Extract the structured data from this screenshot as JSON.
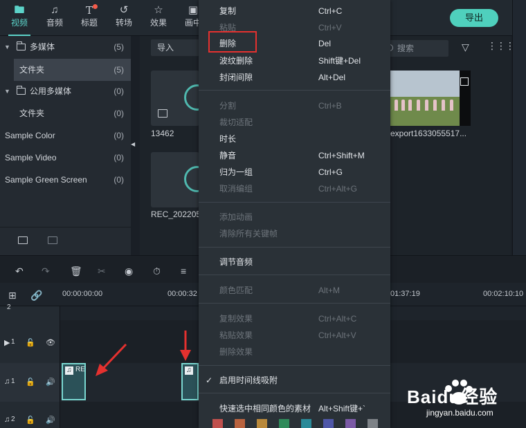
{
  "toolbar": {
    "tabs": [
      {
        "label": "视频",
        "icon": "folder-icon",
        "active": true
      },
      {
        "label": "音频",
        "icon": "music-note-icon",
        "active": false
      },
      {
        "label": "标题",
        "icon": "text-t-icon",
        "active": false
      },
      {
        "label": "转场",
        "icon": "transition-icon",
        "active": false
      },
      {
        "label": "效果",
        "icon": "effects-star-icon",
        "active": false
      },
      {
        "label": "画中",
        "icon": "pip-icon",
        "active": false
      }
    ],
    "export_label": "导出",
    "accent_color": "#5cd3c9"
  },
  "library": {
    "items": [
      {
        "name": "多媒体",
        "count": "(5)",
        "expandable": true
      },
      {
        "name": "文件夹",
        "count": "(5)",
        "selected": true
      },
      {
        "name": "公用多媒体",
        "count": "(0)",
        "expandable": true
      },
      {
        "name": "文件夹",
        "count": "(0)"
      },
      {
        "name": "Sample Color",
        "count": "(0)"
      },
      {
        "name": "Sample Video",
        "count": "(0)"
      },
      {
        "name": "Sample Green Screen",
        "count": "(0)"
      }
    ]
  },
  "media": {
    "import_label": "导入",
    "search_placeholder": "搜索",
    "thumbs": [
      {
        "label": "13462"
      },
      {
        "label": "REC_202205"
      },
      {
        "label": "export1633055517..."
      }
    ]
  },
  "timeline": {
    "ruler_labels": [
      "00:00:00:00",
      "00:00:32",
      "01:37:19",
      "00:02:10:10"
    ],
    "tracks": [
      {
        "label": "2"
      },
      {
        "label": "1"
      },
      {
        "label": "1"
      },
      {
        "label": "2"
      }
    ],
    "clip_label": "RE"
  },
  "context_menu": {
    "items": [
      {
        "label": "复制",
        "key": "Ctrl+C",
        "enabled": true
      },
      {
        "label": "粘贴",
        "key": "Ctrl+V",
        "enabled": false
      },
      {
        "label": "删除",
        "key": "Del",
        "enabled": true,
        "highlighted": true
      },
      {
        "label": "波纹删除",
        "key": "Shift键+Del",
        "enabled": true
      },
      {
        "label": "封闭间隙",
        "key": "Alt+Del",
        "enabled": true
      },
      {
        "label": "分割",
        "key": "Ctrl+B",
        "enabled": false
      },
      {
        "label": "裁切适配",
        "key": "",
        "enabled": false
      },
      {
        "label": "时长",
        "key": "",
        "enabled": true
      },
      {
        "label": "静音",
        "key": "Ctrl+Shift+M",
        "enabled": true
      },
      {
        "label": "归为一组",
        "key": "Ctrl+G",
        "enabled": true
      },
      {
        "label": "取消编组",
        "key": "Ctrl+Alt+G",
        "enabled": false
      },
      {
        "label": "添加动画",
        "key": "",
        "enabled": false
      },
      {
        "label": "清除所有关键帧",
        "key": "",
        "enabled": false
      },
      {
        "label": "调节音频",
        "key": "",
        "enabled": true
      },
      {
        "label": "颜色匹配",
        "key": "Alt+M",
        "enabled": false
      },
      {
        "label": "复制效果",
        "key": "Ctrl+Alt+C",
        "enabled": false
      },
      {
        "label": "粘贴效果",
        "key": "Ctrl+Alt+V",
        "enabled": false
      },
      {
        "label": "删除效果",
        "key": "",
        "enabled": false
      },
      {
        "label": "启用时间线吸附",
        "key": "",
        "enabled": true,
        "checked": true
      },
      {
        "label": "快速选中相同颜色的素材",
        "key": "Alt+Shift键+`",
        "enabled": true
      }
    ],
    "color_swatches": [
      "#c0504d",
      "#c0504d",
      "#b8883a",
      "#2f8a5a",
      "#2a8a99",
      "#4f57a8",
      "#7b5aa6",
      "#7d8287"
    ],
    "highlight_color": "#e5312f"
  },
  "watermark": {
    "brand": "Baidu经验",
    "url": "jingyan.baidu.com"
  }
}
